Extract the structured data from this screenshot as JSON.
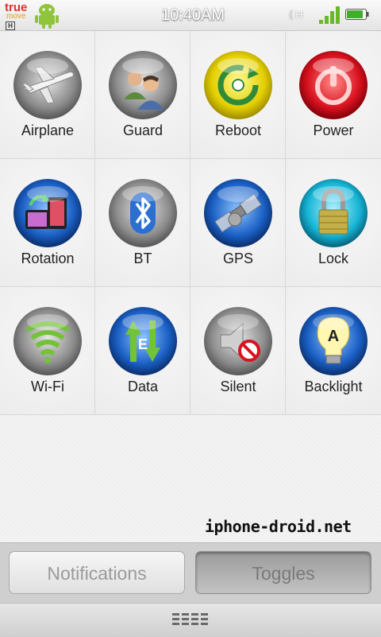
{
  "status_bar": {
    "carrier_line1": "true",
    "carrier_line2": "move",
    "carrier_badge": "H",
    "time": "10:40AM",
    "network_type": "H",
    "signal_icon": "signal-bars-icon",
    "battery_icon": "battery-icon"
  },
  "toggles": [
    {
      "label": "Airplane",
      "icon": "airplane-icon",
      "color": "#8c8c8c"
    },
    {
      "label": "Guard",
      "icon": "guard-people-icon",
      "color": "#8c8c8c"
    },
    {
      "label": "Reboot",
      "icon": "reboot-icon",
      "color": "#e6d200"
    },
    {
      "label": "Power",
      "icon": "power-icon",
      "color": "#d8121f"
    },
    {
      "label": "Rotation",
      "icon": "rotation-icon",
      "color": "#1a5fc4"
    },
    {
      "label": "BT",
      "icon": "bluetooth-icon",
      "color": "#8c8c8c"
    },
    {
      "label": "GPS",
      "icon": "satellite-icon",
      "color": "#1a5fc4"
    },
    {
      "label": "Lock",
      "icon": "padlock-icon",
      "color": "#16b5d6"
    },
    {
      "label": "Wi-Fi",
      "icon": "wifi-icon",
      "color": "#8c8c8c"
    },
    {
      "label": "Data",
      "icon": "data-arrows-icon",
      "color": "#1a5fc4"
    },
    {
      "label": "Silent",
      "icon": "silent-speaker-icon",
      "color": "#8c8c8c"
    },
    {
      "label": "Backlight",
      "icon": "lightbulb-icon",
      "color": "#1a5fc4"
    }
  ],
  "watermark": "iphone-droid.net",
  "tabs": {
    "notifications": "Notifications",
    "toggles": "Toggles",
    "active": "Toggles"
  }
}
